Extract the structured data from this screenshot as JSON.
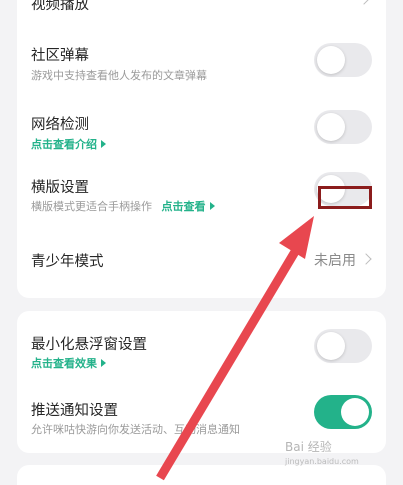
{
  "settings": {
    "video_playback": {
      "title": "视频播放"
    },
    "community_danmaku": {
      "title": "社区弹幕",
      "desc": "游戏中支持查看他人发布的文章弹幕",
      "enabled": false
    },
    "network_check": {
      "title": "网络检测",
      "link": "点击查看介绍",
      "enabled": false
    },
    "landscape": {
      "title": "横版设置",
      "desc": "横版模式更适合手柄操作",
      "link": "点击查看",
      "enabled": false
    },
    "youth_mode": {
      "title": "青少年模式",
      "value": "未启用"
    },
    "floating_window": {
      "title": "最小化悬浮窗设置",
      "link": "点击查看效果",
      "enabled": false
    },
    "push_notify": {
      "title": "推送通知设置",
      "desc": "允许咪咕快游向你发送活动、互动消息通知",
      "enabled": true
    }
  },
  "watermark": {
    "text": "Bai 经验",
    "sub": "jingyan.baidu.com"
  },
  "colors": {
    "accent": "#23b28a",
    "annotation": "#e8474f",
    "highlight": "#8b1c1c"
  }
}
